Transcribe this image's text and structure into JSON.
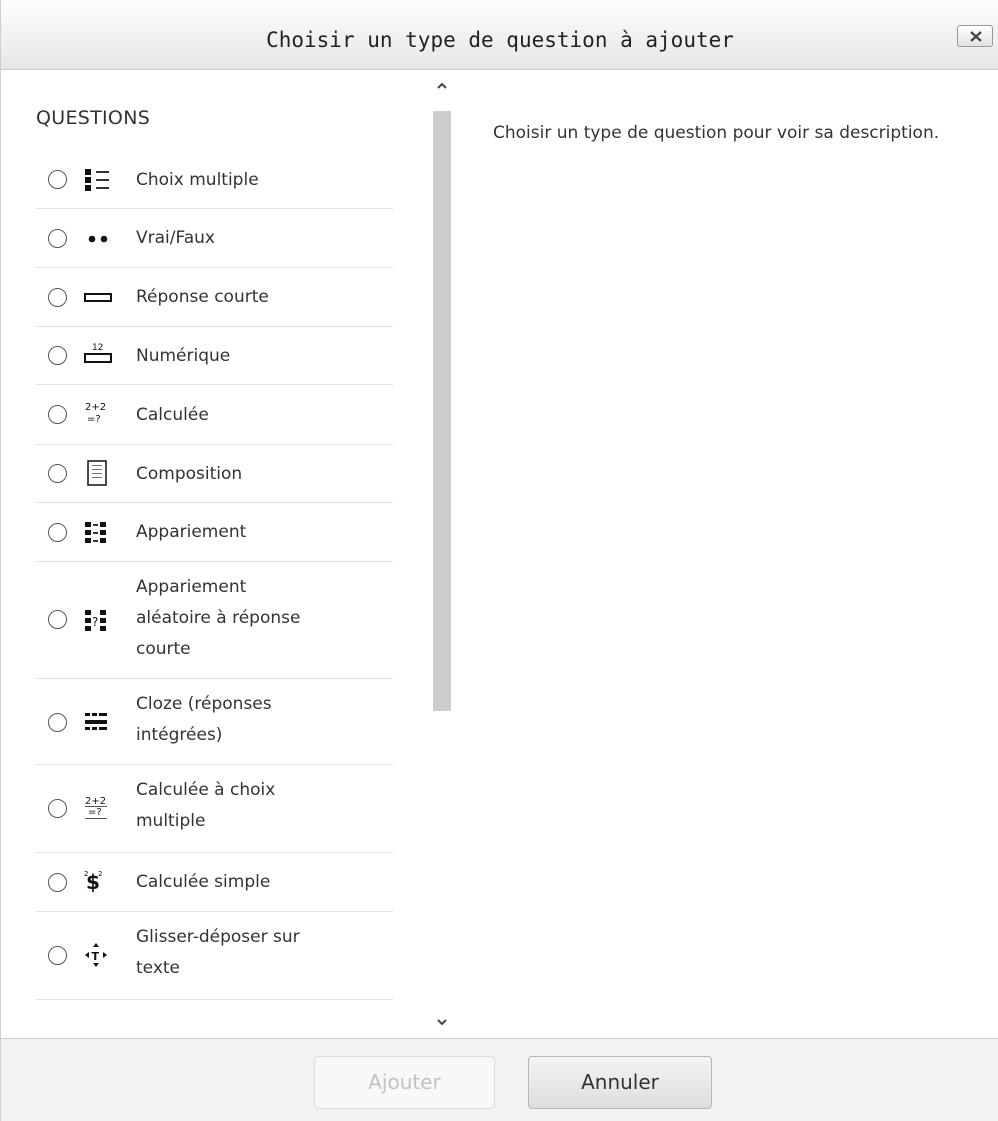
{
  "dialog": {
    "title": "Choisir un type de question à ajouter",
    "close_label": "X"
  },
  "questions": {
    "section_title": "QUESTIONS",
    "items": [
      {
        "label_lines": [
          "Choix multiple"
        ],
        "icon": "multichoice-icon",
        "selected": false
      },
      {
        "label_lines": [
          "Vrai/Faux"
        ],
        "icon": "truefalse-icon",
        "selected": false
      },
      {
        "label_lines": [
          "Réponse courte"
        ],
        "icon": "shortanswer-icon",
        "selected": false
      },
      {
        "label_lines": [
          "Numérique"
        ],
        "icon": "numerical-icon",
        "selected": false
      },
      {
        "label_lines": [
          "Calculée"
        ],
        "icon": "calculated-icon",
        "selected": false
      },
      {
        "label_lines": [
          "Composition"
        ],
        "icon": "essay-icon",
        "selected": false
      },
      {
        "label_lines": [
          "Appariement"
        ],
        "icon": "match-icon",
        "selected": false
      },
      {
        "label_lines": [
          "Appariement",
          "aléatoire à réponse",
          "courte"
        ],
        "icon": "randomsamatch-icon",
        "selected": false
      },
      {
        "label_lines": [
          "Cloze (réponses",
          "intégrées)"
        ],
        "icon": "cloze-icon",
        "selected": false
      },
      {
        "label_lines": [
          "Calculée à choix",
          "multiple"
        ],
        "icon": "calculatedmulti-icon",
        "selected": false
      },
      {
        "label_lines": [
          "Calculée simple"
        ],
        "icon": "calculatedsimple-icon",
        "selected": false
      },
      {
        "label_lines": [
          "Glisser-déposer sur",
          "texte"
        ],
        "icon": "ddwtos-icon",
        "selected": false
      }
    ]
  },
  "description": {
    "text": "Choisir un type de question pour voir sa description."
  },
  "footer": {
    "add_label": "Ajouter",
    "add_enabled": false,
    "cancel_label": "Annuler"
  },
  "colors": {
    "header_bg": "#ececec",
    "footer_bg": "#f2f2f2",
    "scroll_thumb": "#cdcdcd",
    "disabled_text": "#c2c2c2"
  }
}
